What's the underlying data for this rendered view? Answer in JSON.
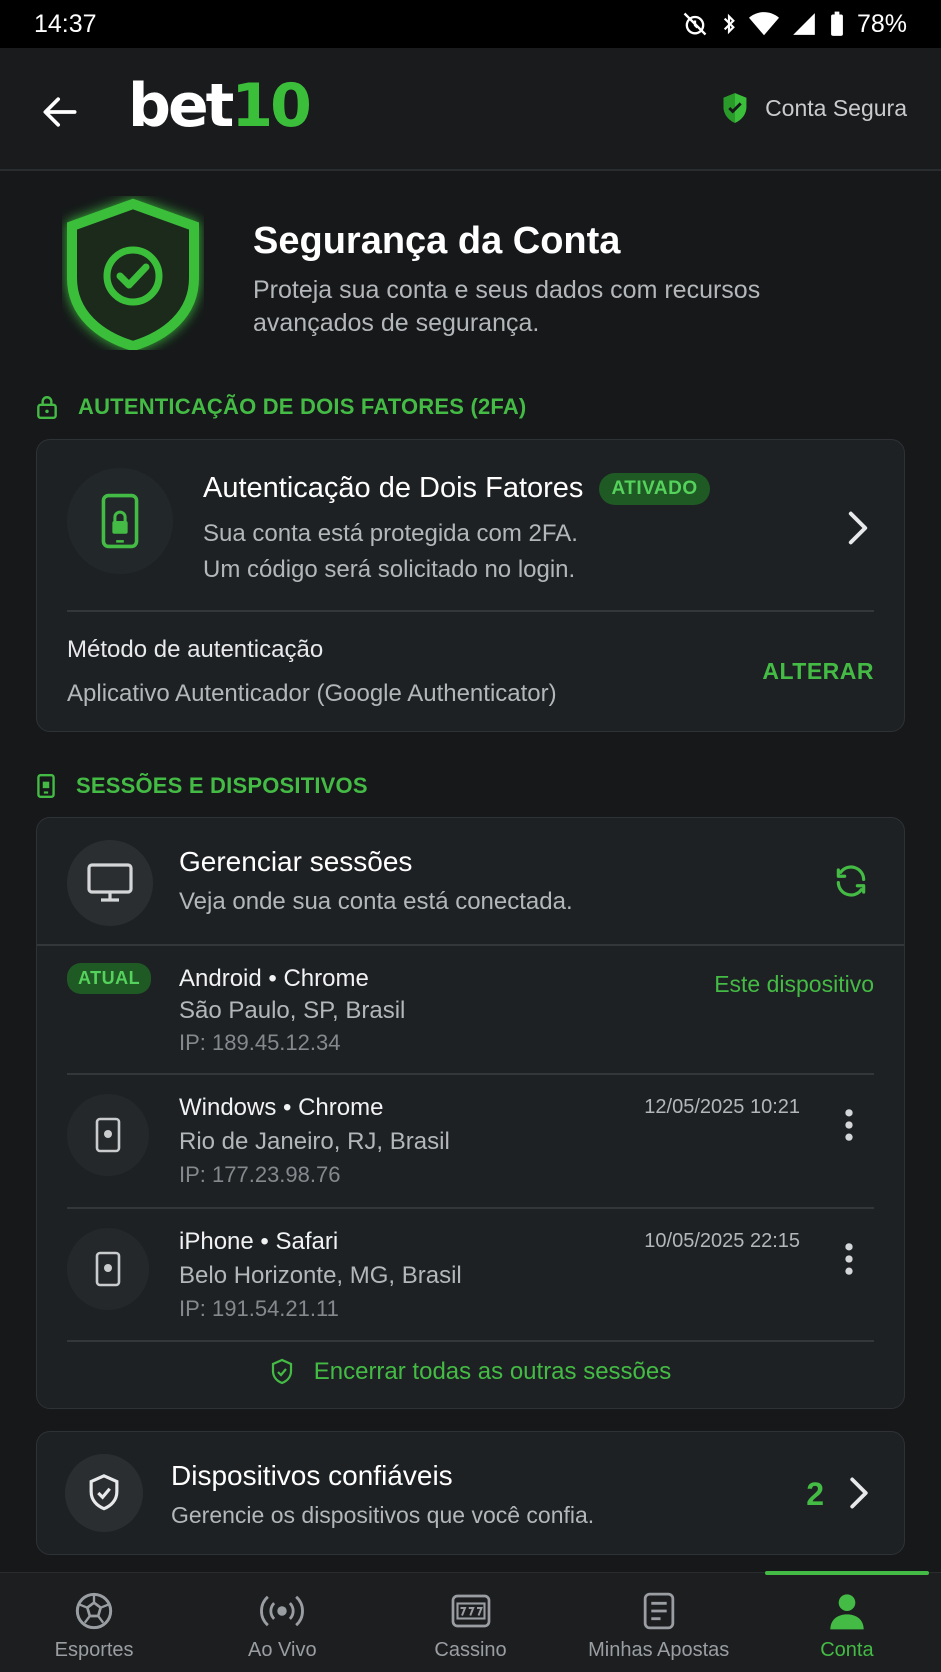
{
  "status_bar": {
    "time": "14:37",
    "battery": "78%"
  },
  "header": {
    "logo_bet": "bet",
    "logo_ten": "10",
    "secure_label": "Conta Segura"
  },
  "hero": {
    "title": "Segurança da Conta",
    "description": "Proteja sua conta e seus dados com recursos avançados de segurança."
  },
  "tfa_section": {
    "label": "AUTENTICAÇÃO DE DOIS FATORES (2FA)",
    "title": "Autenticação de Dois Fatores",
    "badge": "ATIVADO",
    "desc_line1": "Sua conta está protegida com 2FA.",
    "desc_line2": "Um código será solicitado no login.",
    "method_label": "Método de autenticação",
    "method_value": "Aplicativo Autenticador (Google Authenticator)",
    "change_label": "ALTERAR"
  },
  "sessions_section": {
    "label": "SESSÕES E DISPOSITIVOS",
    "title": "Gerenciar sessões",
    "description": "Veja onde sua conta está conectada.",
    "sessions": [
      {
        "badge": "ATUAL",
        "name": "Android • Chrome",
        "location": "São Paulo, SP, Brasil",
        "ip": "IP: 189.45.12.34",
        "current_label": "Este dispositivo"
      },
      {
        "name": "Windows • Chrome",
        "location": "Rio de Janeiro, RJ, Brasil",
        "ip": "IP: 177.23.98.76",
        "date": "12/05/2025 10:21"
      },
      {
        "name": "iPhone • Safari",
        "location": "Belo Horizonte, MG, Brasil",
        "ip": "IP: 191.54.21.11",
        "date": "10/05/2025 22:15"
      }
    ],
    "end_all_label": "Encerrar todas as outras sessões"
  },
  "trusted": {
    "title": "Dispositivos confiáveis",
    "description": "Gerencie os dispositivos que você confia.",
    "count": "2"
  },
  "bottom_nav": [
    {
      "label": "Esportes",
      "icon": "soccer-ball-icon"
    },
    {
      "label": "Ao Vivo",
      "icon": "live-broadcast-icon"
    },
    {
      "label": "Cassino",
      "icon": "slot-machine-icon"
    },
    {
      "label": "Minhas Apostas",
      "icon": "bet-slip-icon"
    },
    {
      "label": "Conta",
      "icon": "user-icon"
    }
  ],
  "colors": {
    "accent": "#44bb44",
    "background": "#16181a",
    "card": "#1e2124"
  }
}
